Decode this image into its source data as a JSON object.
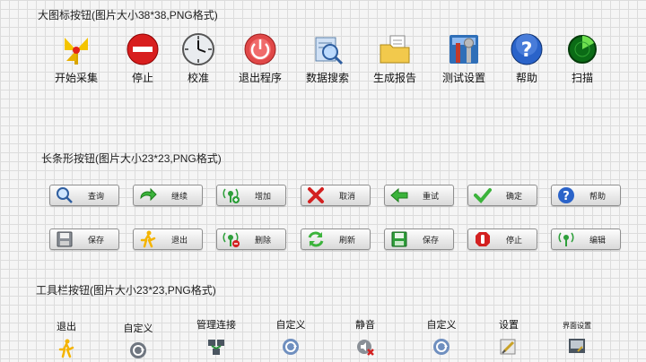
{
  "large_section": {
    "title": "大图标按钮(图片大小38*38,PNG格式)",
    "items": [
      {
        "label": "开始采集",
        "icon": "start-collect-icon"
      },
      {
        "label": "停止",
        "icon": "stop-icon"
      },
      {
        "label": "校准",
        "icon": "clock-icon"
      },
      {
        "label": "退出程序",
        "icon": "power-icon"
      },
      {
        "label": "数据搜索",
        "icon": "data-search-icon"
      },
      {
        "label": "生成报告",
        "icon": "folder-report-icon"
      },
      {
        "label": "测试设置",
        "icon": "tools-icon"
      },
      {
        "label": "帮助",
        "icon": "help-icon"
      },
      {
        "label": "扫描",
        "icon": "radar-icon"
      }
    ]
  },
  "bar_section": {
    "title": "长条形按钮(图片大小23*23,PNG格式)",
    "row1": [
      {
        "label": "查询",
        "icon": "magnifier-icon"
      },
      {
        "label": "继续",
        "icon": "continue-icon"
      },
      {
        "label": "增加",
        "icon": "add-signal-icon"
      },
      {
        "label": "取消",
        "icon": "x-icon"
      },
      {
        "label": "重试",
        "icon": "arrow-left-icon"
      },
      {
        "label": "确定",
        "icon": "checkmark-icon"
      },
      {
        "label": "帮助",
        "icon": "help-icon"
      }
    ],
    "row2": [
      {
        "label": "保存",
        "icon": "floppy-icon"
      },
      {
        "label": "退出",
        "icon": "exit-runner-icon"
      },
      {
        "label": "删除",
        "icon": "delete-signal-icon"
      },
      {
        "label": "刷新",
        "icon": "refresh-icon"
      },
      {
        "label": "保存",
        "icon": "floppy-green-icon"
      },
      {
        "label": "停止",
        "icon": "stop-hand-icon"
      },
      {
        "label": "编辑",
        "icon": "edit-signal-icon"
      }
    ]
  },
  "toolbar_section": {
    "title": "工具栏按钮(图片大小23*23,PNG格式)",
    "items": [
      {
        "label": "退出",
        "icon": "exit-runner-icon"
      },
      {
        "label": "自定义",
        "icon": "custom-icon"
      },
      {
        "label": "管理连接",
        "icon": "network-icon"
      },
      {
        "label": "自定义",
        "icon": "custom-icon"
      },
      {
        "label": "静音",
        "icon": "mute-icon"
      },
      {
        "label": "自定义",
        "icon": "custom-icon"
      },
      {
        "label": "设置",
        "icon": "settings-icon"
      },
      {
        "label": "界面设置",
        "icon": "ui-settings-icon"
      }
    ]
  }
}
